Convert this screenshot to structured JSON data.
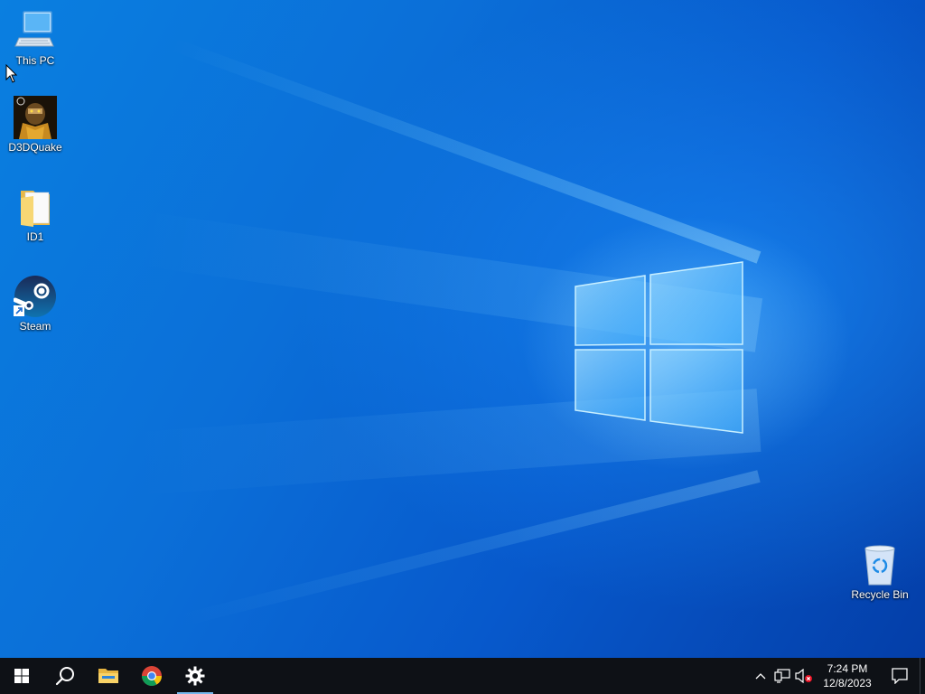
{
  "desktop": {
    "icons": [
      {
        "label": "This PC",
        "icon": "computer-icon"
      },
      {
        "label": "D3DQuake",
        "icon": "quake-app-icon"
      },
      {
        "label": "ID1",
        "icon": "folder-icon"
      },
      {
        "label": "Steam",
        "icon": "steam-icon"
      },
      {
        "label": "Recycle Bin",
        "icon": "recycle-bin-icon"
      }
    ]
  },
  "taskbar": {
    "buttons": [
      {
        "name": "start",
        "icon": "windows-logo-icon"
      },
      {
        "name": "search",
        "icon": "search-icon"
      },
      {
        "name": "file-explorer",
        "icon": "folder-icon"
      },
      {
        "name": "chrome",
        "icon": "chrome-icon"
      },
      {
        "name": "settings",
        "icon": "gear-icon",
        "running": true
      }
    ],
    "tray": {
      "icons": [
        "chevron-up-icon",
        "network-icon",
        "volume-muted-icon"
      ],
      "time": "7:24 PM",
      "date": "12/8/2023",
      "notification_icon": "action-center-icon"
    }
  },
  "colors": {
    "taskbar": "#0e1116",
    "accent": "#76b9ed",
    "wallpaper_blue": "#0b6fd8"
  }
}
